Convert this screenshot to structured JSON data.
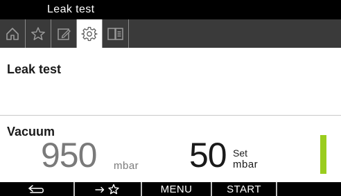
{
  "window": {
    "title": "Leak test"
  },
  "tabs": [
    {
      "icon": "home-icon",
      "active": false
    },
    {
      "icon": "star-icon",
      "active": false
    },
    {
      "icon": "edit-icon",
      "active": false
    },
    {
      "icon": "gear-icon",
      "active": true
    },
    {
      "icon": "book-icon",
      "active": false
    }
  ],
  "page": {
    "heading": "Leak test"
  },
  "vacuum": {
    "label": "Vacuum",
    "actual_value": "950",
    "actual_unit": "mbar",
    "set_value": "50",
    "set_label": "Set",
    "set_unit": "mbar",
    "status_color": "#9acd1e"
  },
  "softkeys": [
    {
      "icon": "back-arrow-icon",
      "label": ""
    },
    {
      "icon": "arrow-to-favorites-icon",
      "label": ""
    },
    {
      "icon": "",
      "label": "MENU"
    },
    {
      "icon": "",
      "label": "START"
    },
    {
      "icon": "",
      "label": ""
    }
  ],
  "colors": {
    "titlebar_bg": "#000000",
    "tabbar_bg": "#3a3a3a",
    "accent_green": "#9acd1e",
    "actual_value_gray": "#7a7a7a"
  }
}
